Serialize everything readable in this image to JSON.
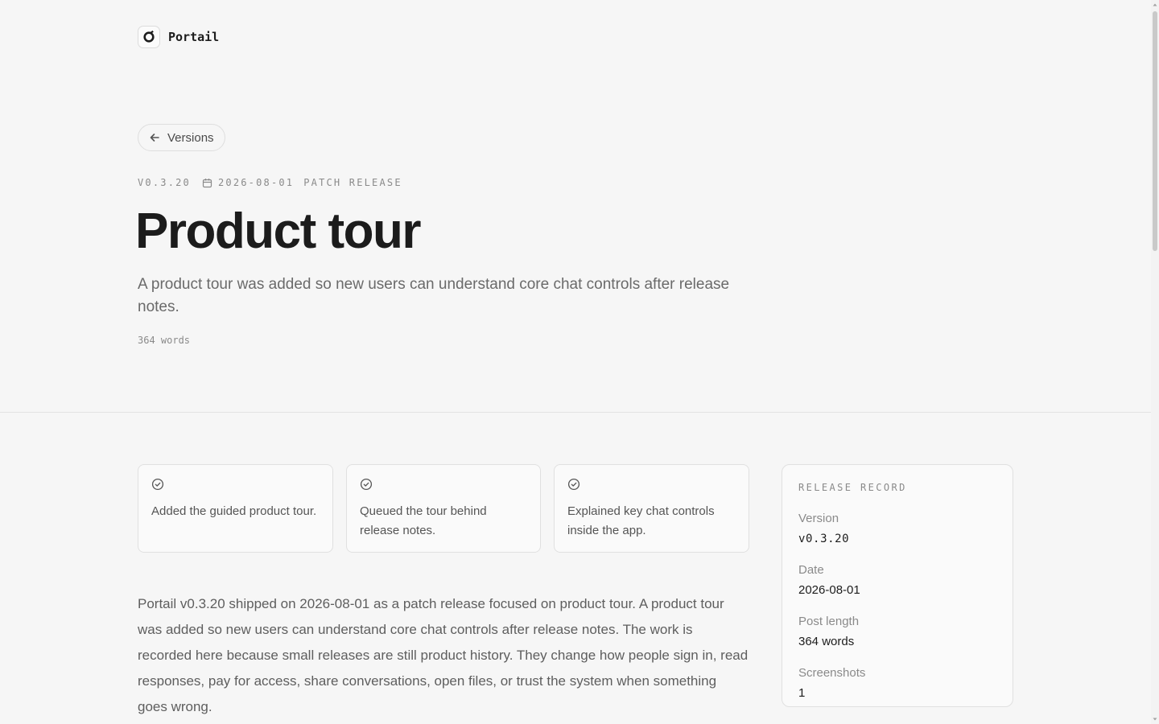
{
  "brand": {
    "name": "Portail",
    "logo_icon": "portail-logo-icon"
  },
  "back_link": {
    "label": "Versions",
    "icon": "arrow-left-icon"
  },
  "meta": {
    "version": "V0.3.20",
    "date": "2026-08-01",
    "kind": "PATCH RELEASE",
    "date_icon": "calendar-icon"
  },
  "title": "Product tour",
  "subtitle": "A product tour was added so new users can understand core chat controls after release notes.",
  "word_count": "364 words",
  "highlights": [
    {
      "icon": "check-circle-icon",
      "text": "Added the guided product tour."
    },
    {
      "icon": "check-circle-icon",
      "text": "Queued the tour behind release notes."
    },
    {
      "icon": "check-circle-icon",
      "text": "Explained key chat controls inside the app."
    }
  ],
  "body": "Portail v0.3.20 shipped on 2026-08-01 as a patch release focused on product tour. A product tour was added so new users can understand core chat controls after release notes. The work is recorded here because small releases are still product history. They change how people sign in, read responses, pay for access, share conversations, open files, or trust the system when something goes wrong.",
  "release_record": {
    "title": "RELEASE RECORD",
    "items": [
      {
        "label": "Version",
        "value": "v0.3.20"
      },
      {
        "label": "Date",
        "value": "2026-08-01"
      },
      {
        "label": "Post length",
        "value": "364 words"
      },
      {
        "label": "Screenshots",
        "value": "1"
      }
    ]
  },
  "colors": {
    "background": "#f6f6f6",
    "text": "#1c1c1c",
    "muted": "#8a8a8a",
    "border": "#e0e0e0"
  }
}
